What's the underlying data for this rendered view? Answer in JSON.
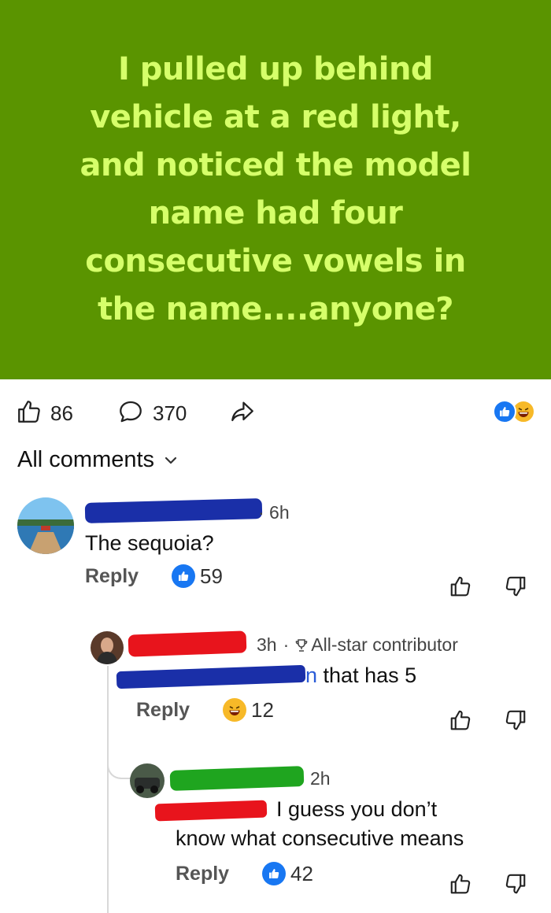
{
  "post": {
    "text": "I pulled up behind\nvehicle at a red light,\nand noticed the model\nname had four\nconsecutive vowels in\nthe name....anyone?",
    "background_color": "#5a9400",
    "text_color": "#d6ff6a"
  },
  "actions": {
    "like_count": "86",
    "comment_count": "370",
    "like_icon": "thumbs-up-icon",
    "comment_icon": "comment-bubble-icon",
    "share_icon": "share-arrow-icon",
    "reaction_icons": [
      "like-reaction-icon",
      "laugh-reaction-icon"
    ]
  },
  "comments_header": {
    "label": "All comments",
    "icon": "chevron-down-icon"
  },
  "comments": [
    {
      "time": "· 6h",
      "text": "The sequoia?",
      "reply_label": "Reply",
      "reaction_icon": "like-reaction-icon",
      "reaction_count": "59",
      "name_redaction_color": "#1a2fa8"
    },
    {
      "time": "3h",
      "separator": "·",
      "badge": "All-star contributor",
      "badge_icon": "trophy-icon",
      "mention_tail": "n",
      "text": " that has 5",
      "reply_label": "Reply",
      "reaction_icon": "laugh-reaction-icon",
      "reaction_count": "12",
      "name_redaction_color": "#e8141c",
      "mention_redaction_color": "#1a2fa8"
    },
    {
      "time": "2h",
      "text_line1": "I guess you don’t",
      "text_line2": "know what consecutive means",
      "reply_label": "Reply",
      "reaction_icon": "like-reaction-icon",
      "reaction_count": "42",
      "name_redaction_color": "#1fa51f",
      "mention_redaction_color": "#e8141c"
    }
  ]
}
